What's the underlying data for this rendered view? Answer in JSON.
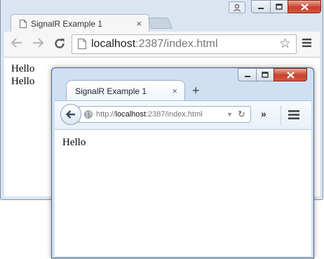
{
  "chrome": {
    "tab_title": "SignalR Example 1",
    "tab_close": "×",
    "url_host": "localhost",
    "url_rest": ":2387/index.html",
    "content_lines": [
      "Hello",
      "Hello"
    ]
  },
  "firefox": {
    "tab_title": "SignalR Example 1",
    "tab_close": "×",
    "new_tab": "+",
    "url_prefix": "http://",
    "url_host": "localhost",
    "url_rest": ":2387/index.html",
    "overflow": "»",
    "content_lines": [
      "Hello"
    ]
  },
  "icons": {
    "chrome_back": "arrow-left-icon",
    "chrome_forward": "arrow-right-icon",
    "chrome_reload": "reload-icon",
    "chrome_star": "star-icon",
    "chrome_menu": "hamburger-menu-icon",
    "ff_back": "arrow-left-icon",
    "ff_globe": "globe-icon",
    "ff_menu": "hamburger-menu-icon"
  },
  "colors": {
    "close_button": "#c9412c",
    "window_frame": "#dbe5f2",
    "firefox_frame": "#cfe0f2"
  }
}
